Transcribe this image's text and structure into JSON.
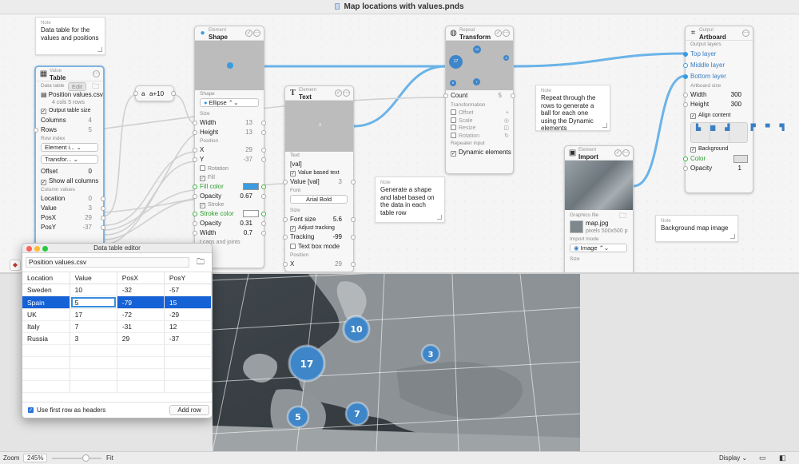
{
  "window": {
    "title": "Map locations with values.pnds"
  },
  "notes": [
    {
      "label": "Note",
      "text": "Data table for the values and positions"
    },
    {
      "label": "Note",
      "text": "Repeat through the rows to generate a ball for each one using the Dynamic elements"
    },
    {
      "label": "Note",
      "text": "Generate a shape and label based on the data in each table row"
    },
    {
      "label": "Note",
      "text": "Background map image"
    }
  ],
  "value_table": {
    "category": "Value",
    "title": "Table",
    "data_table_label": "Data table",
    "edit_label": "Edit",
    "file_name": "Position values.csv",
    "file_info": "4 cols 5 rows",
    "output_table_size": "Output table size",
    "columns_label": "Columns",
    "columns_value": "4",
    "rows_label": "Rows",
    "rows_value": "5",
    "row_index_label": "Row index",
    "element_dd": "Element i...",
    "transform_dd": "Transfor...",
    "offset_label": "Offset",
    "offset_value": "0",
    "show_all": "Show all columns",
    "column_values": "Column values",
    "location_label": "Location",
    "location_value": "0",
    "value_label": "Value",
    "value_value": "3",
    "posx_label": "PosX",
    "posx_value": "29",
    "posy_label": "PosY",
    "posy_value": "-37"
  },
  "expr_node": {
    "var": "a",
    "expr": "a+10"
  },
  "shape_node": {
    "category": "Element",
    "title": "Shape",
    "shape_label": "Shape",
    "shape_value": "Ellipse",
    "size_label": "Size",
    "width_label": "Width",
    "width_value": "13",
    "height_label": "Height",
    "height_value": "13",
    "position_label": "Position",
    "x_label": "X",
    "x_value": "29",
    "y_label": "Y",
    "y_value": "-37",
    "rotation_label": "Rotation",
    "fill_label": "Fill",
    "fill_color_label": "Fill color",
    "opacity_label": "Opacity",
    "opacity_value": "0.67",
    "stroke_label": "Stroke",
    "stroke_color_label": "Stroke color",
    "stroke_opacity_value": "0.31",
    "stroke_width_label": "Width",
    "stroke_width_value": "0.7",
    "caps_label": "t caps and joints"
  },
  "text_node": {
    "category": "Element",
    "title": "Text",
    "text_label": "Text",
    "text_value": "[val]",
    "value_based": "Value based text",
    "value_label": "Value [val]",
    "value_value": "3",
    "font_label": "Font",
    "font_value": "Arial Bold",
    "size_label": "Size",
    "font_size_label": "Font size",
    "font_size_value": "5.6",
    "adjust_tracking": "Adjust tracking",
    "tracking_label": "Tracking",
    "tracking_value": "-99",
    "text_box_mode": "Text box mode",
    "position_label": "Position",
    "x_label": "X",
    "x_value": "29"
  },
  "repeat_node": {
    "category": "Repeat",
    "title": "Transform",
    "count_label": "Count",
    "count_value": "5",
    "transformation_label": "Transformation",
    "offset": "Offset",
    "scale": "Scale",
    "resize": "Resize",
    "rotation": "Rotation",
    "repeater_input": "Repeater input",
    "dynamic": "Dynamic elements",
    "preview_balls": [
      "10",
      "17",
      "3",
      "5",
      "7"
    ]
  },
  "import_node": {
    "category": "Element",
    "title": "Import",
    "graphics_file": "Graphics file",
    "file_name": "map.jpg",
    "file_info": "pixels 500x500 p",
    "import_mode_label": "Import mode",
    "import_mode_value": "Image",
    "size_label": "Size"
  },
  "output_node": {
    "category": "Output",
    "title": "Artboard",
    "layers_label": "Output layers",
    "layers": [
      "Top layer",
      "Middle layer",
      "Bottom layer"
    ],
    "size_label": "Artboard size",
    "width_label": "Width",
    "width_value": "300",
    "height_label": "Height",
    "height_value": "300",
    "align_content": "Align content",
    "background_label": "Background",
    "color_label": "Color",
    "opacity_label": "Opacity",
    "opacity_value": "1"
  },
  "editor": {
    "title": "Data table editor",
    "file_name": "Position values.csv",
    "columns": [
      "Location",
      "Value",
      "PosX",
      "PosY"
    ],
    "rows": [
      [
        "Sweden",
        "10",
        "-32",
        "-57"
      ],
      [
        "Spain",
        "5",
        "-79",
        "15"
      ],
      [
        "UK",
        "17",
        "-72",
        "-29"
      ],
      [
        "Italy",
        "7",
        "-31",
        "12"
      ],
      [
        "Russia",
        "3",
        "29",
        "-37"
      ]
    ],
    "selected_row": 1,
    "use_first_row": "Use first row as headers",
    "add_row": "Add row"
  },
  "map_balls": [
    "10",
    "3",
    "17",
    "5",
    "7"
  ],
  "bottom": {
    "zoom_label": "Zoom",
    "zoom_value": "245%",
    "fit_label": "Fit",
    "display_label": "Display"
  },
  "colors": {
    "accent": "#3a9be0",
    "ball": "#3f86c8",
    "selection": "#1561d6"
  }
}
